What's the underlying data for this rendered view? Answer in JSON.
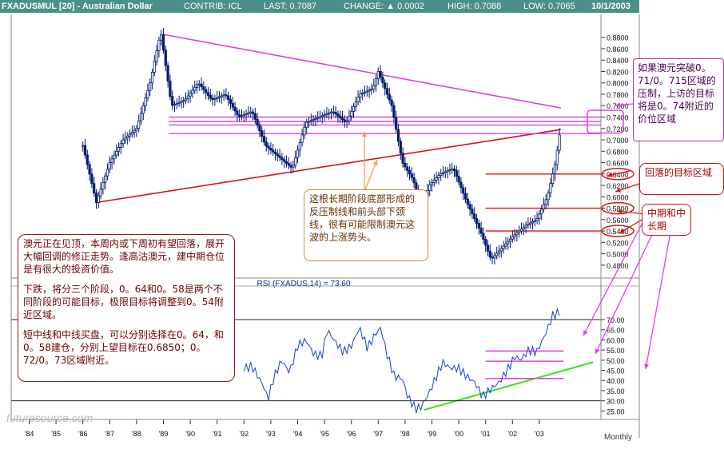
{
  "header": {
    "symbol": "FXADUSMUL [20] - Australian Dollar",
    "contrib": "CONTRIB: ICL",
    "last": "LAST: 0.7087",
    "change": "CHANGE: ▲ 0.0002",
    "high": "HIGH: 0.7088",
    "low": "LOW: 0.7065",
    "date": "10/1/2003"
  },
  "colors": {
    "header_bg": "#4a8f8a",
    "candles": "#001a6e",
    "rsi_line": "#1a3fd0",
    "magenta": "#e040e0",
    "red": "#dd1111",
    "green": "#44dd22",
    "orange": "#f0a050"
  },
  "watermark": "futuresource.com",
  "chart_data": [
    {
      "type": "candlestick",
      "frequency": "Monthly",
      "x_ticks": [
        "'84",
        "'85",
        "'86",
        "'87",
        "'88",
        "'89",
        "'90",
        "'91",
        "'92",
        "'93",
        "'94",
        "'95",
        "'96",
        "'97",
        "'98",
        "'99",
        "'00",
        "'01",
        "'02",
        "'03"
      ],
      "y_ticks": [
        "0.8800",
        "0.8600",
        "0.8400",
        "0.8200",
        "0.8000",
        "0.7800",
        "0.7600",
        "0.7400",
        "0.7200",
        "0.7000",
        "0.6800",
        "0.6600",
        "0.6400",
        "0.6200",
        "0.6000",
        "0.5800",
        "0.5600",
        "0.5400",
        "0.5200",
        "0.5000",
        "0.4800"
      ],
      "ylim": [
        0.47,
        0.895
      ],
      "series": [
        {
          "x": [
            1986.0,
            1986.5,
            1987.0,
            1987.5,
            1988.0,
            1988.5,
            1988.9,
            1989.3,
            1989.8,
            1990.3,
            1990.8,
            1991.3,
            1991.8,
            1992.3,
            1992.8,
            1993.3,
            1993.8,
            1994.3,
            1994.8,
            1995.3,
            1995.8,
            1996.3,
            1996.8,
            1997.0,
            1997.5,
            1997.9,
            1998.3,
            1998.6,
            1998.9,
            1999.3,
            1999.8,
            2000.3,
            2000.8,
            2001.2,
            2001.6,
            2002.0,
            2002.5,
            2002.9,
            2003.3,
            2003.6,
            2003.75
          ],
          "y": [
            0.69,
            0.59,
            0.66,
            0.7,
            0.72,
            0.8,
            0.89,
            0.76,
            0.77,
            0.8,
            0.77,
            0.78,
            0.74,
            0.75,
            0.69,
            0.67,
            0.65,
            0.73,
            0.74,
            0.75,
            0.73,
            0.78,
            0.79,
            0.82,
            0.76,
            0.66,
            0.63,
            0.58,
            0.62,
            0.64,
            0.65,
            0.59,
            0.54,
            0.49,
            0.51,
            0.53,
            0.55,
            0.56,
            0.6,
            0.66,
            0.7087
          ]
        }
      ],
      "overlays": [
        {
          "name": "descending trendline",
          "from": [
            1989.0,
            0.885
          ],
          "to": [
            2003.8,
            0.756
          ]
        },
        {
          "name": "rising trendline",
          "from": [
            1986.5,
            0.59
          ],
          "to": [
            2003.8,
            0.718
          ]
        },
        {
          "name": "horizontal",
          "y": 0.74
        },
        {
          "name": "horizontal",
          "y": 0.732
        },
        {
          "name": "horizontal",
          "y": 0.726
        },
        {
          "name": "horizontal",
          "y": 0.711
        },
        {
          "name": "target",
          "y": 0.64
        },
        {
          "name": "target",
          "y": 0.58
        },
        {
          "name": "target",
          "y": 0.54
        }
      ],
      "circled_ticks": [
        "0.6400",
        "0.5800",
        "0.5400"
      ]
    },
    {
      "type": "line",
      "title": "RSI (FXADUS,14) = 73.60",
      "y_ticks": [
        "70.00",
        "65.00",
        "60.00",
        "55.00",
        "50.00",
        "45.00",
        "40.00",
        "35.00",
        "30.00",
        "25.00"
      ],
      "ylim": [
        22,
        81
      ],
      "series": [
        {
          "x": [
            1992.0,
            1992.3,
            1992.7,
            1992.9,
            1993.1,
            1993.4,
            1993.7,
            1994.0,
            1994.3,
            1994.6,
            1994.9,
            1995.1,
            1995.4,
            1995.7,
            1996.0,
            1996.3,
            1996.6,
            1996.9,
            1997.1,
            1997.3,
            1997.6,
            1997.9,
            1998.1,
            1998.4,
            1998.6,
            1998.9,
            1999.1,
            1999.4,
            1999.7,
            2000.0,
            2000.3,
            2000.6,
            2000.9,
            2001.2,
            2001.5,
            2001.8,
            2002.1,
            2002.3,
            2002.6,
            2002.9,
            2003.2,
            2003.5,
            2003.75
          ],
          "y": [
            46,
            47,
            38,
            31,
            41,
            50,
            44,
            57,
            60,
            53,
            52,
            65,
            59,
            54,
            57,
            66,
            56,
            63,
            66,
            54,
            42,
            41,
            32,
            26,
            27,
            34,
            40,
            49,
            46,
            46,
            42,
            39,
            32,
            36,
            39,
            45,
            52,
            50,
            55,
            54,
            62,
            72,
            73.6
          ]
        }
      ],
      "overlays": [
        {
          "name": "uptrend",
          "from": [
            1998.7,
            25.5
          ],
          "to": [
            2005.0,
            49.0
          ]
        },
        {
          "name": "horizontal",
          "y": 54.5
        },
        {
          "name": "horizontal",
          "y": 49.5
        },
        {
          "name": "horizontal",
          "y": 41.0
        },
        {
          "name": "reference",
          "y": 70.0
        },
        {
          "name": "reference",
          "y": 30.0
        }
      ]
    }
  ],
  "annotations": {
    "left": [
      "澳元正在见顶，本周内或下周初有望回落，展开大幅回调的修正走势。逢高沽澳元，建中期仓位是有很大的投资价值。",
      "下跌，将分三个阶段，0。64和0。58是两个不同阶段的可能目标，极限目标将调整到0。54附近区域。",
      "短中线和中线买盘，可以分别选择在0。64，和0。58建仓，分别上望目标在0.6850；0。72/0。73区域附近。"
    ],
    "middle": "这根长期阶段底部形成的反压制线和前头部下颈线，很有可能限制澳元这波的上涨势头。",
    "right_top": "如果澳元突破0。71/0。715区域的压制，上访的目标将是0。74附近的价位区域",
    "right_mid": "回落的目标区域",
    "right_low": "中期和中长期"
  }
}
